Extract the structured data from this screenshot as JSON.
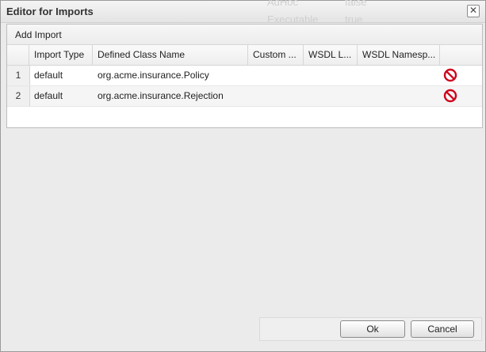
{
  "dialog": {
    "title": "Editor for Imports",
    "close_icon": "close-icon"
  },
  "background": {
    "text1": "AdHoc",
    "text2": "false",
    "text3": "Executable",
    "text4": "true"
  },
  "toolbar": {
    "add_import_label": "Add Import"
  },
  "grid": {
    "columns": [
      "Import Type",
      "Defined Class Name",
      "Custom ...",
      "WSDL L...",
      "WSDL Namesp..."
    ],
    "rows": [
      {
        "num": "1",
        "import_type": "default",
        "class_name": "org.acme.insurance.Policy",
        "custom": "",
        "wsdl_location": "",
        "wsdl_namespace": "",
        "delete_icon": "delete-icon"
      },
      {
        "num": "2",
        "import_type": "default",
        "class_name": "org.acme.insurance.Rejection",
        "custom": "",
        "wsdl_location": "",
        "wsdl_namespace": "",
        "delete_icon": "delete-icon"
      }
    ]
  },
  "buttons": {
    "ok": "Ok",
    "cancel": "Cancel"
  },
  "colors": {
    "delete_red": "#d0021b"
  }
}
